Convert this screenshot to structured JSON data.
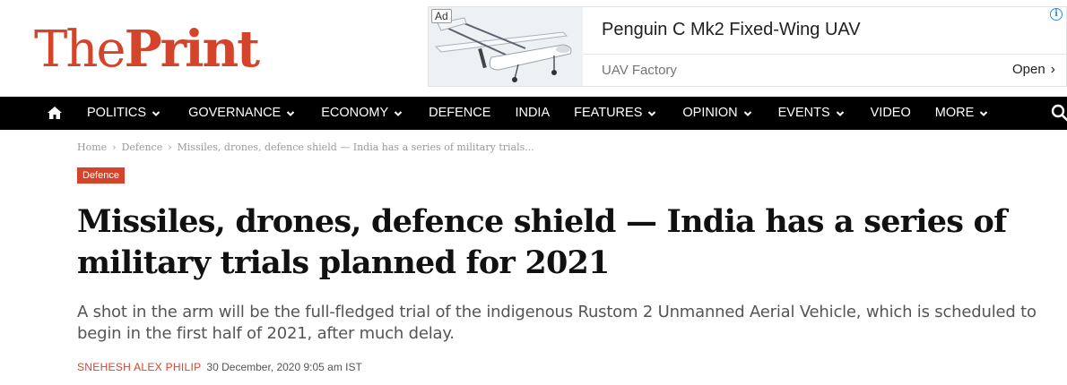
{
  "header": {
    "logo_part1": "The",
    "logo_part2": "Print",
    "brand_color": "#d4442b"
  },
  "ad": {
    "badge": "Ad",
    "title": "Penguin C Mk2 Fixed-Wing UAV",
    "sponsor": "UAV Factory",
    "cta": "Open",
    "info_icon": "info-icon"
  },
  "nav": {
    "home_icon": "home-icon",
    "search_icon": "search-icon",
    "items": [
      {
        "label": "POLITICS",
        "dropdown": true
      },
      {
        "label": "GOVERNANCE",
        "dropdown": true
      },
      {
        "label": "ECONOMY",
        "dropdown": true
      },
      {
        "label": "DEFENCE",
        "dropdown": false
      },
      {
        "label": "INDIA",
        "dropdown": false
      },
      {
        "label": "FEATURES",
        "dropdown": true
      },
      {
        "label": "OPINION",
        "dropdown": true
      },
      {
        "label": "EVENTS",
        "dropdown": true
      },
      {
        "label": "VIDEO",
        "dropdown": false
      },
      {
        "label": "MORE",
        "dropdown": true
      }
    ]
  },
  "breadcrumb": {
    "home": "Home",
    "section": "Defence",
    "current": "Missiles, drones, defence shield — India has a series of military trials...",
    "separator": "›"
  },
  "article": {
    "category": "Defence",
    "title": "Missiles, drones, defence shield — India has a series of military trials planned for 2021",
    "subtitle": "A shot in the arm will be the full-fledged trial of the indigenous Rustom 2 Unmanned Aerial Vehicle, which is scheduled to begin in the first half of 2021, after much delay.",
    "author": "Snehesh Alex Philip",
    "date": "30 December, 2020 9:05 am IST"
  }
}
